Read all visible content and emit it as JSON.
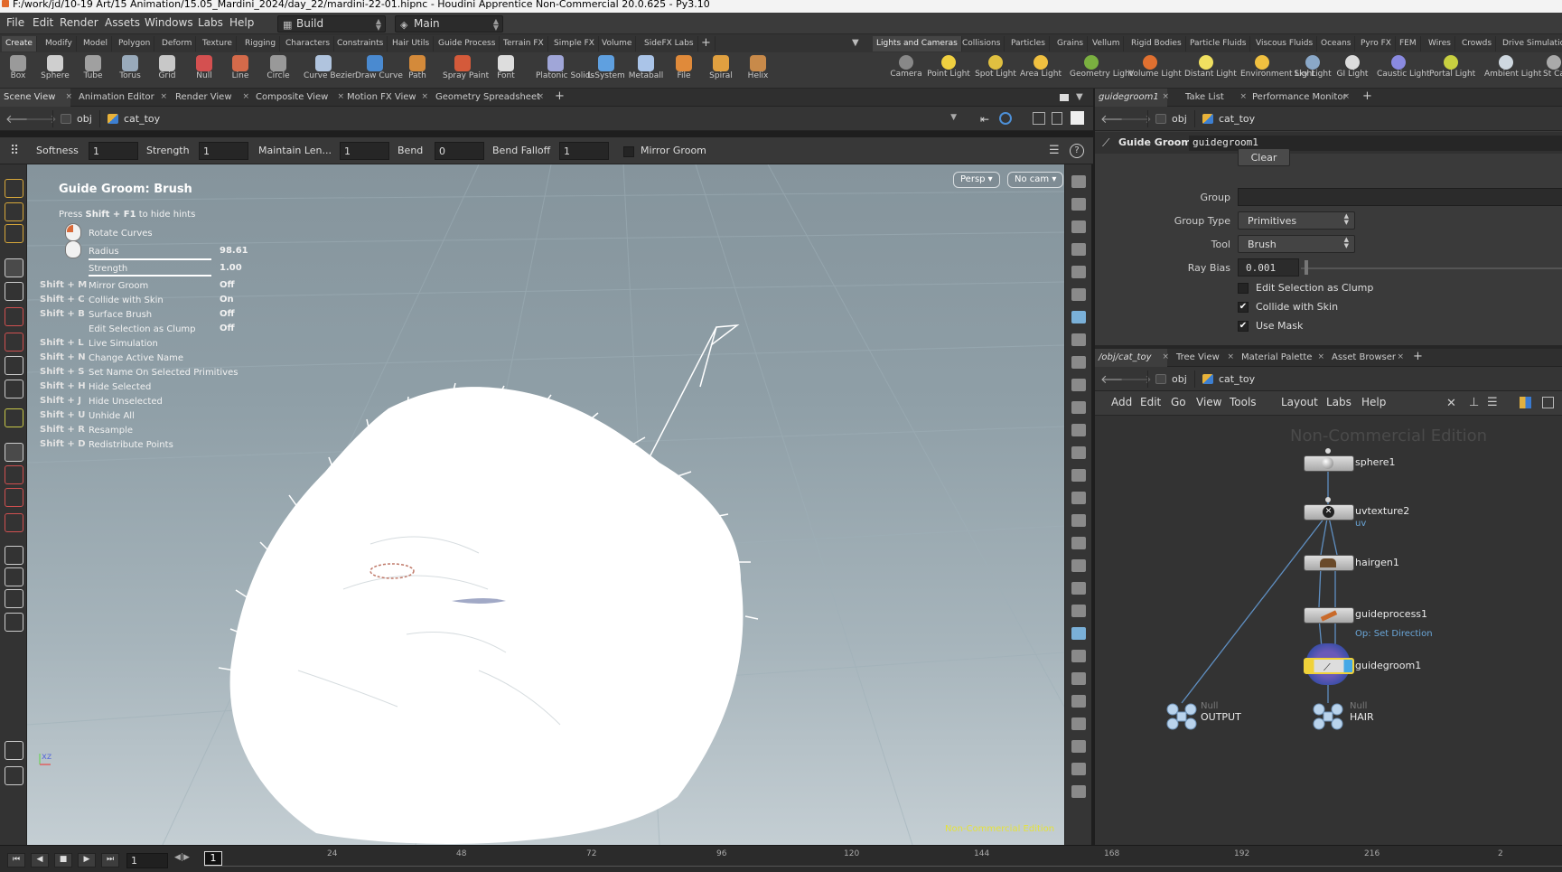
{
  "window": {
    "title": "F:/work/jd/10-19 Art/15 Animation/15.05_Mardini_2024/day_22/mardini-22-01.hipnc - Houdini Apprentice Non-Commercial 20.0.625 - Py3.10"
  },
  "menubar": {
    "items": [
      "File",
      "Edit",
      "Render",
      "Assets",
      "Windows",
      "Labs",
      "Help"
    ],
    "desktop": "Build",
    "network_desk": "Main"
  },
  "shelf": {
    "left_tabs": [
      "Create",
      "Modify",
      "Model",
      "Polygon",
      "Deform",
      "Texture",
      "Rigging",
      "Characters",
      "Constraints",
      "Hair Utils",
      "Guide Process",
      "Terrain FX",
      "Simple FX",
      "Volume",
      "SideFX Labs",
      "+"
    ],
    "right_tabs": [
      "Lights and Cameras",
      "Collisions",
      "Particles",
      "Grains",
      "Vellum",
      "Rigid Bodies",
      "Particle Fluids",
      "Viscous Fluids",
      "Oceans",
      "Pyro FX",
      "FEM",
      "Wires",
      "Crowds",
      "Drive Simulation"
    ],
    "left_tools": [
      "Box",
      "Sphere",
      "Tube",
      "Torus",
      "Grid",
      "Null",
      "Line",
      "Circle",
      "Curve Bezier",
      "Draw Curve",
      "Path",
      "Spray Paint",
      "Font",
      "Platonic Solids",
      "L-System",
      "Metaball",
      "File",
      "Spiral",
      "Helix"
    ],
    "right_tools": [
      "Camera",
      "Point Light",
      "Spot Light",
      "Area Light",
      "Geometry Light",
      "Volume Light",
      "Distant Light",
      "Environment Light",
      "Sky Light",
      "GI Light",
      "Caustic Light",
      "Portal Light",
      "Ambient Light",
      "St Ca"
    ]
  },
  "viewer": {
    "tabs": [
      "Scene View",
      "Animation Editor",
      "Render View",
      "Composite View",
      "Motion FX View",
      "Geometry Spreadsheet",
      "+"
    ],
    "path": [
      "obj",
      "cat_toy"
    ],
    "options": {
      "softness_label": "Softness",
      "softness": "1",
      "strength_label": "Strength",
      "strength": "1",
      "maintain_label": "Maintain Len...",
      "maintain": "1",
      "bend_label": "Bend",
      "bend": "0",
      "bend_falloff_label": "Bend Falloff",
      "bend_falloff": "1",
      "mirror_label": "Mirror Groom"
    },
    "hints": {
      "title": "Guide Groom: Brush",
      "press": "Press",
      "press_key": "Shift + F1",
      "press_suffix": "to hide hints",
      "rotate": "Rotate Curves",
      "radius_label": "Radius",
      "radius": "98.61",
      "strength_label": "Strength",
      "strength": "1.00",
      "rows": [
        {
          "key": "Shift + M",
          "label": "Mirror Groom",
          "value": "Off"
        },
        {
          "key": "Shift + C",
          "label": "Collide with Skin",
          "value": "On"
        },
        {
          "key": "Shift + B",
          "label": "Surface Brush",
          "value": "Off"
        },
        {
          "key": "",
          "label": "Edit Selection as Clump",
          "value": "Off"
        }
      ],
      "shortcuts": [
        {
          "key": "Shift + L",
          "label": "Live Simulation"
        },
        {
          "key": "Shift + N",
          "label": "Change Active Name"
        },
        {
          "key": "Shift + S",
          "label": "Set Name On Selected Primitives"
        },
        {
          "key": "Shift + H",
          "label": "Hide Selected"
        },
        {
          "key": "Shift + J",
          "label": "Hide Unselected"
        },
        {
          "key": "Shift + U",
          "label": "Unhide All"
        },
        {
          "key": "Shift + R",
          "label": "Resample"
        },
        {
          "key": "Shift + D",
          "label": "Redistribute Points"
        }
      ]
    },
    "persp": "Persp",
    "cam": "No cam",
    "watermark": "Non-Commercial Edition",
    "axis": "xz"
  },
  "params": {
    "tabs": [
      "guidegroom1",
      "Take List",
      "Performance Monitor",
      "+"
    ],
    "path": [
      "obj",
      "cat_toy"
    ],
    "node_type": "Guide Groom",
    "node_name": "guidegroom1",
    "clear": "Clear",
    "group_label": "Group",
    "group_type_label": "Group Type",
    "group_type": "Primitives",
    "tool_label": "Tool",
    "tool": "Brush",
    "ray_bias_label": "Ray Bias",
    "ray_bias": "0.001",
    "edit_clump": "Edit Selection as Clump",
    "collide": "Collide with Skin",
    "use_mask": "Use Mask"
  },
  "network": {
    "tabs": [
      "/obj/cat_toy",
      "Tree View",
      "Material Palette",
      "Asset Browser",
      "+"
    ],
    "path": [
      "obj",
      "cat_toy"
    ],
    "menus": [
      "Add",
      "Edit",
      "Go",
      "View",
      "Tools",
      "Layout",
      "Labs",
      "Help"
    ],
    "watermark": "Non-Commercial Edition",
    "nodes": {
      "sphere": "sphere1",
      "uvtexture": "uvtexture2",
      "uvtexture_sub": "uv",
      "hairgen": "hairgen1",
      "guideprocess": "guideprocess1",
      "guideprocess_sub": "Op: Set Direction",
      "guidegroom": "guidegroom1",
      "output_type": "Null",
      "output": "OUTPUT",
      "hair_type": "Null",
      "hair": "HAIR"
    }
  },
  "timeline": {
    "frame": "1",
    "current": "1",
    "ticks": [
      "24",
      "48",
      "72",
      "96",
      "120",
      "144",
      "168",
      "192",
      "216",
      "2"
    ]
  }
}
